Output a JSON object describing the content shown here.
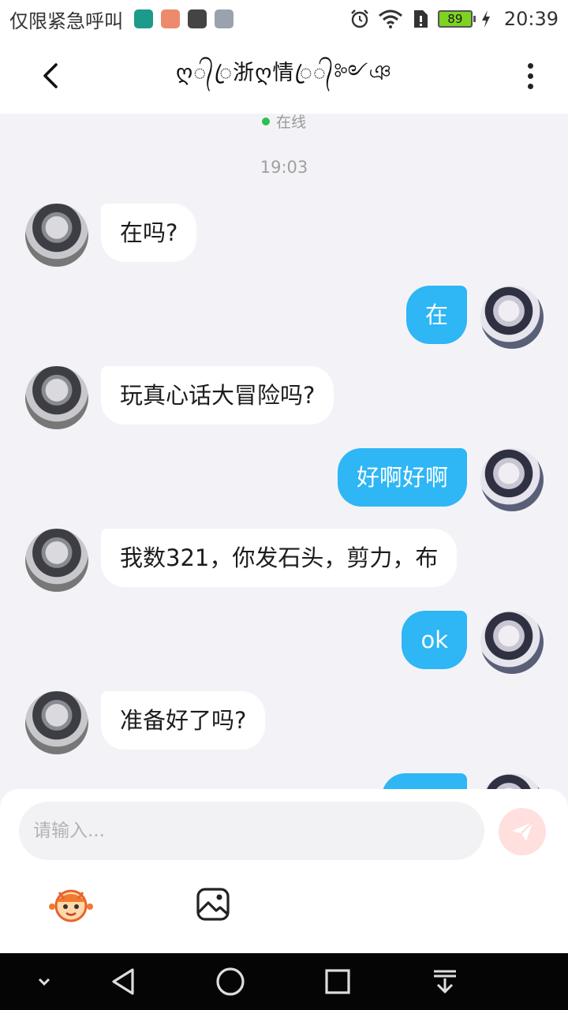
{
  "status_bar": {
    "carrier": "仅限紧急呼叫",
    "battery_level": "89",
    "time": "20:39"
  },
  "header": {
    "contact_name": "ღ᭄ꦿ浙ღ情ꦿ᭄༻ঞ",
    "online_status": "在线"
  },
  "chat": {
    "timestamp": "19:03",
    "messages": [
      {
        "side": "left",
        "text": "在吗?"
      },
      {
        "side": "right",
        "text": "在"
      },
      {
        "side": "left",
        "text": "玩真心话大冒险吗?"
      },
      {
        "side": "right",
        "text": "好啊好啊"
      },
      {
        "side": "left",
        "text": "我数321，你发石头，剪力，布"
      },
      {
        "side": "right",
        "text": "ok"
      },
      {
        "side": "left",
        "text": "准备好了吗?"
      }
    ]
  },
  "composer": {
    "placeholder": "请输入..."
  },
  "icons": {
    "back": "chevron-left-icon",
    "more": "more-vertical-icon",
    "send": "paper-plane-icon",
    "sticker": "mascot-sticker-icon",
    "image": "image-picker-icon",
    "nav_hide": "chevron-down-icon",
    "nav_back": "triangle-back-icon",
    "nav_home": "circle-home-icon",
    "nav_recents": "square-recents-icon",
    "nav_notifications": "pull-down-icon"
  },
  "colors": {
    "outgoing_bubble": "#2eb6f5",
    "incoming_bubble": "#ffffff",
    "online_dot": "#27c24c",
    "send_button": "#ffe0de"
  }
}
